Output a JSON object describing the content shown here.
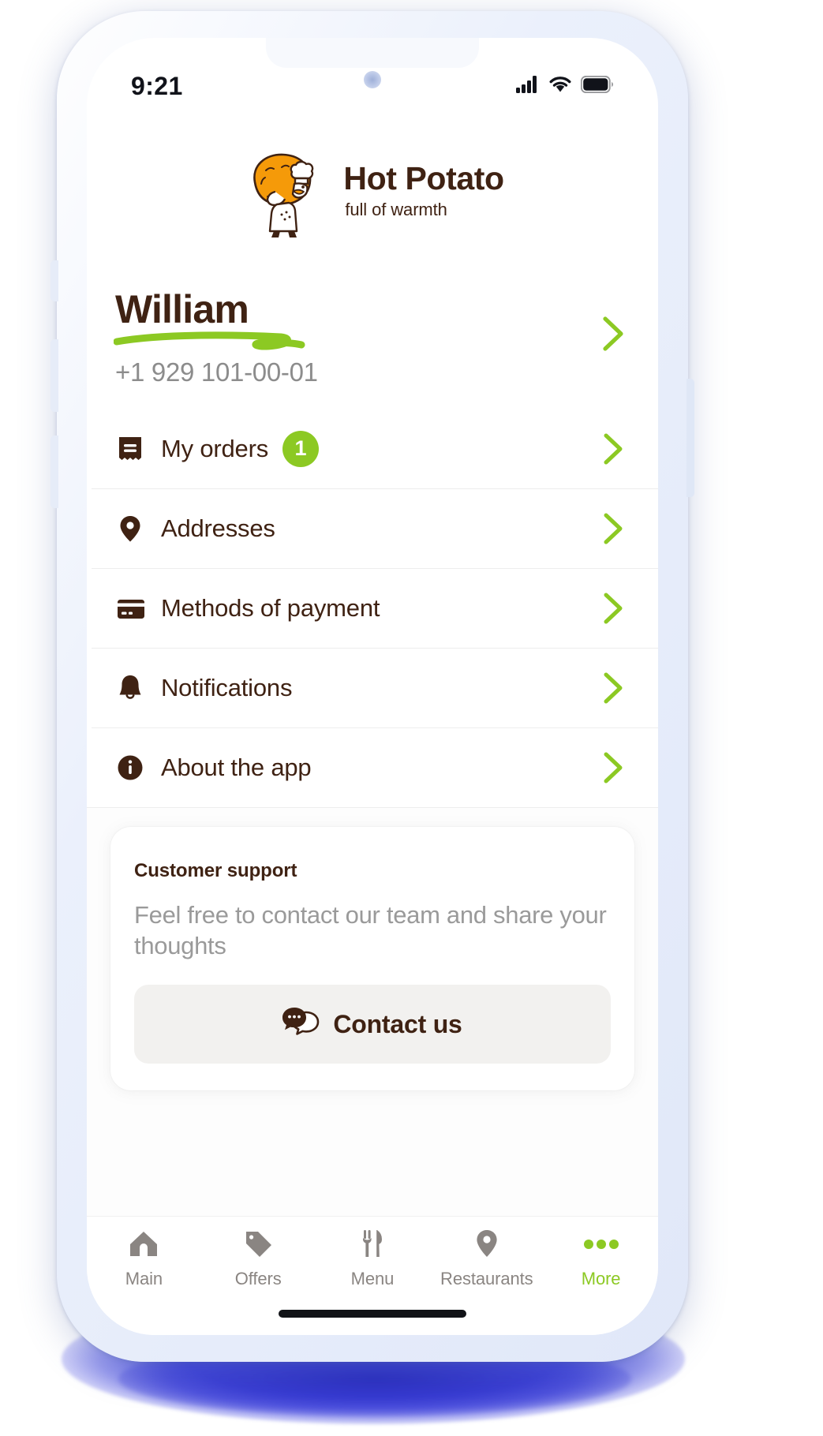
{
  "colors": {
    "brand_brown": "#3f2213",
    "brand_orange": "#F59A09",
    "accent_green": "#8cc923",
    "muted_gray": "#8a8582",
    "phone_body": "#eef2fb"
  },
  "status_bar": {
    "time": "9:21",
    "icons": [
      "cellular-signal-icon",
      "wifi-icon",
      "battery-icon"
    ]
  },
  "brand": {
    "logo_icon": "chef-with-potato-logo",
    "title": "Hot Potato",
    "tagline": "full of warmth"
  },
  "profile": {
    "name": "William",
    "phone": "+1 929 101-00-01",
    "chevron_icon": "chevron-right-icon"
  },
  "menu": {
    "items": [
      {
        "label": "My orders",
        "icon": "receipt-icon",
        "badge": "1"
      },
      {
        "label": "Addresses",
        "icon": "location-pin-icon",
        "badge": ""
      },
      {
        "label": "Methods of payment",
        "icon": "credit-card-icon",
        "badge": ""
      },
      {
        "label": "Notifications",
        "icon": "bell-icon",
        "badge": ""
      },
      {
        "label": "About the app",
        "icon": "info-circle-icon",
        "badge": ""
      }
    ]
  },
  "support": {
    "title": "Customer support",
    "body": "Feel free to contact our team and share your thoughts",
    "button_label": "Contact us",
    "button_icon": "chat-bubbles-icon"
  },
  "tab_bar": {
    "items": [
      {
        "label": "Main",
        "icon": "home-icon",
        "active": false
      },
      {
        "label": "Offers",
        "icon": "price-tag-icon",
        "active": false
      },
      {
        "label": "Menu",
        "icon": "fork-knife-icon",
        "active": false
      },
      {
        "label": "Restaurants",
        "icon": "location-pin-icon",
        "active": false
      },
      {
        "label": "More",
        "icon": "three-dots-icon",
        "active": true
      }
    ]
  }
}
